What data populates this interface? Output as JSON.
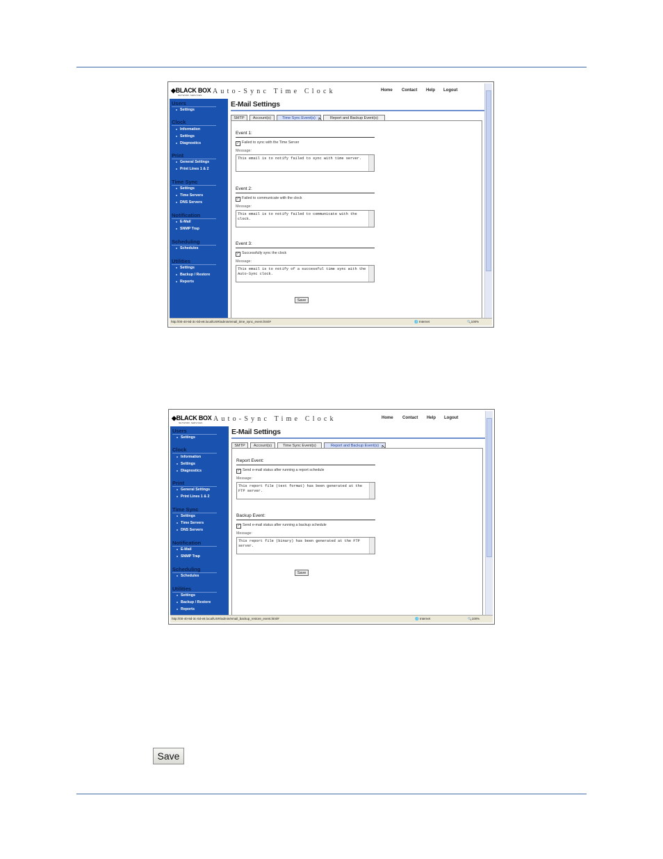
{
  "screenshots": [
    {
      "logo": "BLACK BOX",
      "logo_sub": "NETWORK SERVICES",
      "app_title": "Auto-Sync Time Clock",
      "topnav": [
        "Home",
        "Contact",
        "Help",
        "Logout"
      ],
      "sidebar": [
        {
          "group": "Users",
          "items": [
            "Settings"
          ]
        },
        {
          "group": "Clock",
          "items": [
            "Information",
            "Settings",
            "Diagnostics"
          ]
        },
        {
          "group": "Print",
          "items": [
            "General Settings",
            "Print Lines 1 & 2"
          ]
        },
        {
          "group": "Time Sync",
          "items": [
            "Settings",
            "Time Servers",
            "DNS Servers"
          ]
        },
        {
          "group": "Notification",
          "items": [
            "E-Mail",
            "SNMP Trap"
          ]
        },
        {
          "group": "Scheduling",
          "items": [
            "Schedules"
          ]
        },
        {
          "group": "Utilities",
          "items": [
            "Settings",
            "Backup / Restore",
            "Reports"
          ]
        }
      ],
      "page_title": "E-Mail Settings",
      "tabs": [
        {
          "label": "SMTP",
          "active": false
        },
        {
          "label": "Account(s)",
          "active": false
        },
        {
          "label": "Time Sync Event(s)",
          "active": true
        },
        {
          "label": "Report and Backup Event(s)",
          "active": false
        }
      ],
      "events": [
        {
          "title": "Event 1:",
          "checkbox": "Failed to sync with the Time Server",
          "checked": true,
          "message_label": "Message:",
          "message": "This email is to notify failed to sync with time server."
        },
        {
          "title": "Event 2:",
          "checkbox": "Failed to communicate with the clock",
          "checked": true,
          "message_label": "Message:",
          "message": "This email is to notify failed to communicate with the clock."
        },
        {
          "title": "Event 3:",
          "checkbox": "Successfully sync the clock",
          "checked": true,
          "message_label": "Message:",
          "message": "This email is to notify of a successful time sync with the Auto-Sync clock."
        }
      ],
      "save_label": "Save",
      "status_url": "http://00-40-9d-3c-0d-e8.local/USR/admin/email_time_sync_event.html#",
      "status_zone": "Internet",
      "status_zoom": "100%"
    },
    {
      "logo": "BLACK BOX",
      "logo_sub": "NETWORK SERVICES",
      "app_title": "Auto-Sync Time Clock",
      "topnav": [
        "Home",
        "Contact",
        "Help",
        "Logout"
      ],
      "sidebar": [
        {
          "group": "Users",
          "items": [
            "Settings"
          ]
        },
        {
          "group": "Clock",
          "items": [
            "Information",
            "Settings",
            "Diagnostics"
          ]
        },
        {
          "group": "Print",
          "items": [
            "General Settings",
            "Print Lines 1 & 2"
          ]
        },
        {
          "group": "Time Sync",
          "items": [
            "Settings",
            "Time Servers",
            "DNS Servers"
          ]
        },
        {
          "group": "Notification",
          "items": [
            "E-Mail",
            "SNMP Trap"
          ]
        },
        {
          "group": "Scheduling",
          "items": [
            "Schedules"
          ]
        },
        {
          "group": "Utilities",
          "items": [
            "Settings",
            "Backup / Restore",
            "Reports"
          ]
        }
      ],
      "page_title": "E-Mail Settings",
      "tabs": [
        {
          "label": "SMTP",
          "active": false
        },
        {
          "label": "Account(s)",
          "active": false
        },
        {
          "label": "Time Sync Event(s)",
          "active": false
        },
        {
          "label": "Report and Backup Event(s)",
          "active": true
        }
      ],
      "events": [
        {
          "title": "Report Event:",
          "checkbox": "Send e-mail status after running a report schedule",
          "checked": true,
          "message_label": "Message:",
          "message": "This report file (text format) has been generated at the FTP server."
        },
        {
          "title": "Backup Event:",
          "checkbox": "Send e-mail status after running a backup schedule",
          "checked": true,
          "message_label": "Message:",
          "message": "This report file (binary) has been generated at the FTP server."
        }
      ],
      "save_label": "Save",
      "status_url": "http://00-40-9d-3c-0d-e8.local/USR/admin/email_backup_restore_event.html#",
      "status_zone": "Internet",
      "status_zoom": "100%"
    }
  ],
  "standalone_save_label": "Save",
  "colors": {
    "rule": "#3d6aa8",
    "sidebar": "#1a52b0",
    "active_tab": "#d9e2f7"
  }
}
